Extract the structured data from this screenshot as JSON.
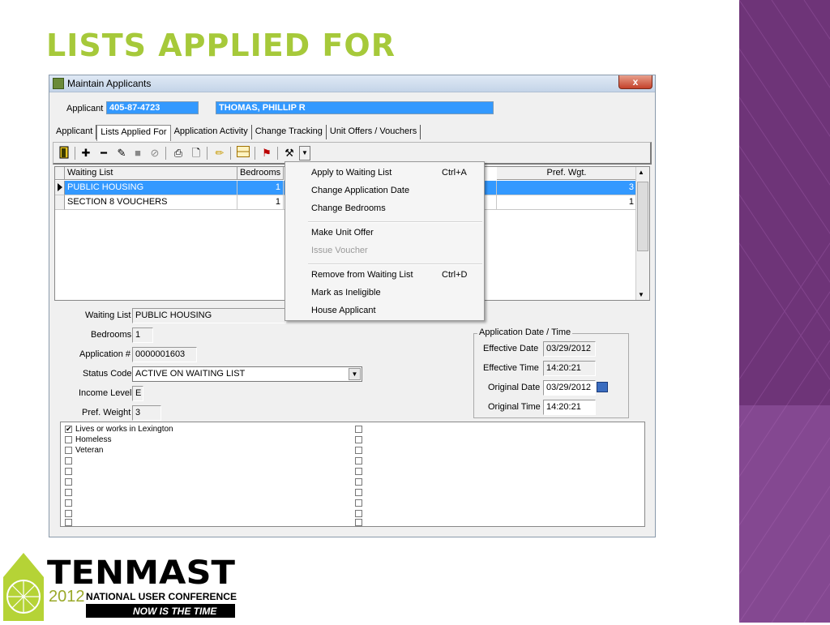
{
  "slide": {
    "title": "LISTS APPLIED FOR"
  },
  "window": {
    "title": "Maintain Applicants",
    "close_label": "x"
  },
  "applicant": {
    "label": "Applicant",
    "id": "405-87-4723",
    "name": "THOMAS, PHILLIP R"
  },
  "tabs": [
    {
      "label": "Applicant"
    },
    {
      "label": "Lists Applied For"
    },
    {
      "label": "Application Activity"
    },
    {
      "label": "Change Tracking"
    },
    {
      "label": "Unit Offers / Vouchers"
    }
  ],
  "toolbar": {
    "icons": [
      "exit-icon",
      "add-icon",
      "remove-icon",
      "edit-icon",
      "save-icon",
      "cancel-icon",
      "print-icon",
      "new-document-icon",
      "highlighter-icon",
      "layout-icon",
      "flag-icon",
      "tools-icon",
      "dropdown-arrow-icon"
    ]
  },
  "grid": {
    "columns": {
      "waiting_list": "Waiting List",
      "bedrooms": "Bedrooms",
      "pref_wgt": "Pref. Wgt."
    },
    "rows": [
      {
        "waiting_list": "PUBLIC HOUSING",
        "bedrooms": "1",
        "pref_wgt": "3"
      },
      {
        "waiting_list": "SECTION 8 VOUCHERS",
        "bedrooms": "1",
        "pref_wgt": "1"
      }
    ]
  },
  "context_menu": {
    "items": [
      {
        "label": "Apply to Waiting List",
        "shortcut": "Ctrl+A"
      },
      {
        "label": "Change Application Date",
        "shortcut": ""
      },
      {
        "label": "Change Bedrooms",
        "shortcut": ""
      },
      {
        "label": "Make Unit Offer",
        "shortcut": ""
      },
      {
        "label": "Issue Voucher",
        "shortcut": "",
        "disabled": true
      },
      {
        "label": "Remove from Waiting List",
        "shortcut": "Ctrl+D"
      },
      {
        "label": "Mark as Ineligible",
        "shortcut": ""
      },
      {
        "label": "House Applicant",
        "shortcut": ""
      }
    ]
  },
  "details": {
    "waiting_list": {
      "label": "Waiting List",
      "value": "PUBLIC HOUSING"
    },
    "bedrooms": {
      "label": "Bedrooms",
      "value": "1"
    },
    "application_no": {
      "label": "Application #",
      "value": "0000001603"
    },
    "status_code": {
      "label": "Status Code",
      "value": "ACTIVE ON WAITING LIST"
    },
    "income_level": {
      "label": "Income Level",
      "value": "E"
    },
    "pref_weight": {
      "label": "Pref. Weight",
      "value": "3"
    }
  },
  "app_date": {
    "group_title": "Application Date / Time",
    "effective_date": {
      "label": "Effective Date",
      "value": "03/29/2012"
    },
    "effective_time": {
      "label": "Effective Time",
      "value": "14:20:21"
    },
    "original_date": {
      "label": "Original Date",
      "value": "03/29/2012"
    },
    "original_time": {
      "label": "Original Time",
      "value": "14:20:21"
    }
  },
  "preferences": [
    {
      "label": "Lives or works in Lexington",
      "checked": true
    },
    {
      "label": "Homeless",
      "checked": false
    },
    {
      "label": "Veteran",
      "checked": false
    }
  ],
  "logo": {
    "brand": "TENMAST",
    "year": "2012",
    "conference": "NATIONAL USER CONFERENCE",
    "tagline": "NOW IS THE TIME"
  },
  "colors": {
    "title_green": "#a6c93a",
    "band_purple": "#7b3d86",
    "selection_blue": "#3399ff"
  }
}
